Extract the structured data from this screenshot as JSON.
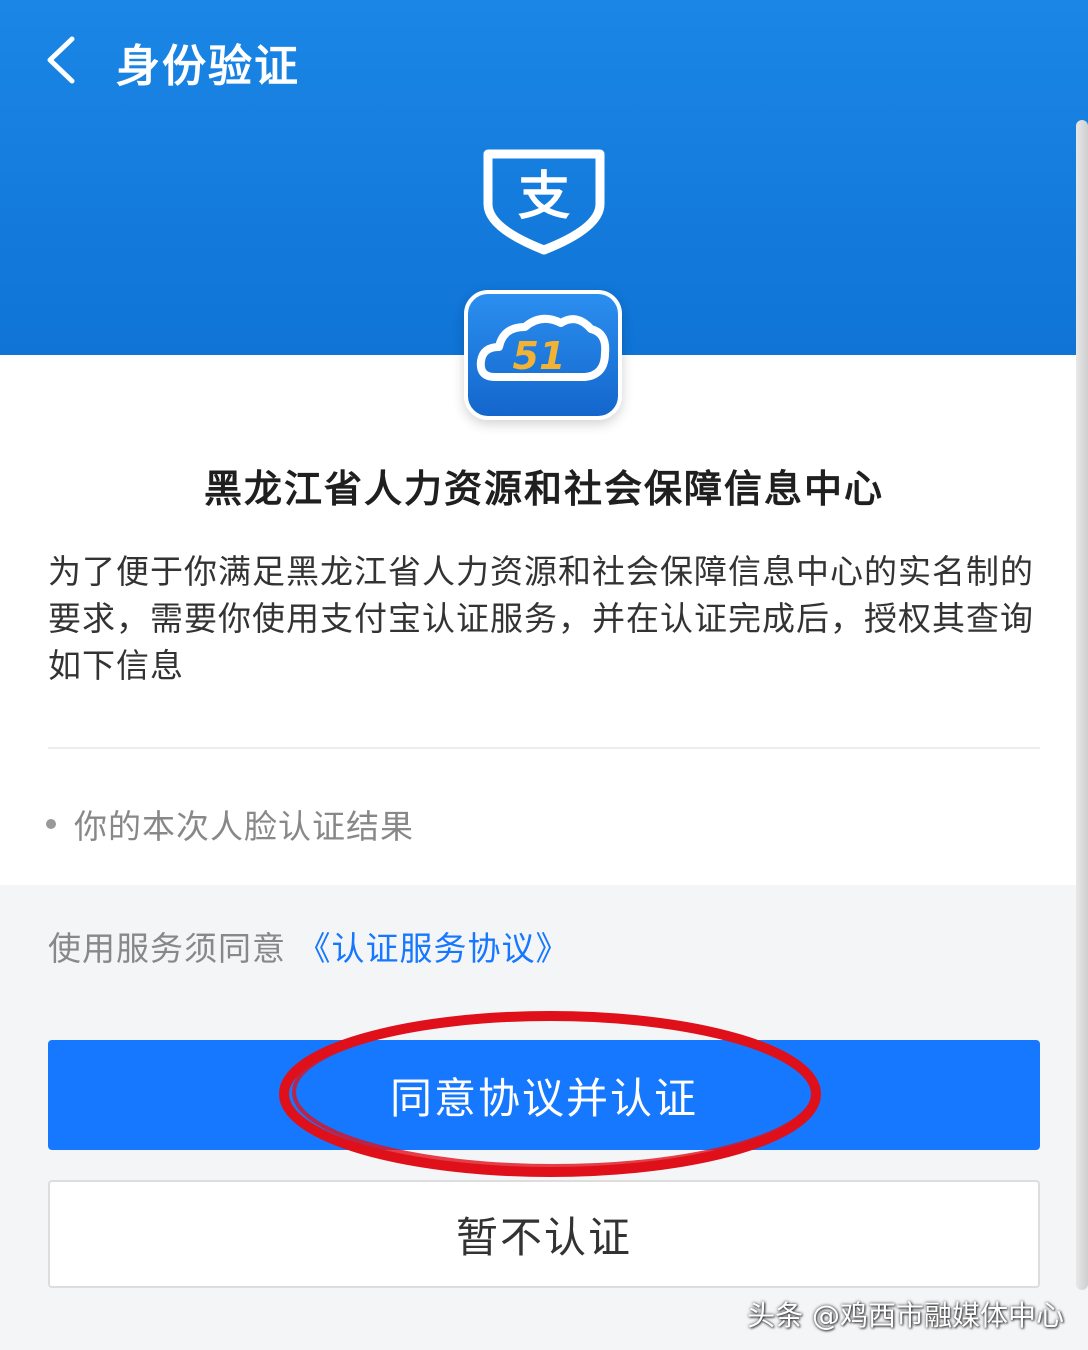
{
  "header": {
    "title": "身份验证",
    "back_icon": "chevron-left-icon",
    "shield_icon": "alipay-shield-icon",
    "shield_char": "支"
  },
  "app": {
    "icon": "cloud-51-app-icon",
    "icon_text": "51",
    "org_name": "黑龙江省人力资源和社会保障信息中心"
  },
  "description": "为了便于你满足黑龙江省人力资源和社会保障信息中心的实名制的要求，需要你使用支付宝认证服务，并在认证完成后，授权其查询如下信息",
  "info_items": [
    {
      "label": "你的本次人脸认证结果"
    }
  ],
  "agreement": {
    "prefix": "使用服务须同意",
    "link": "《认证服务协议》"
  },
  "buttons": {
    "agree": "同意协议并认证",
    "decline": "暂不认证"
  },
  "watermark": "头条 @鸡西市融媒体中心",
  "colors": {
    "header_blue": "#1677ff",
    "link_blue": "#1677ff",
    "highlight_red": "#e0101a"
  }
}
